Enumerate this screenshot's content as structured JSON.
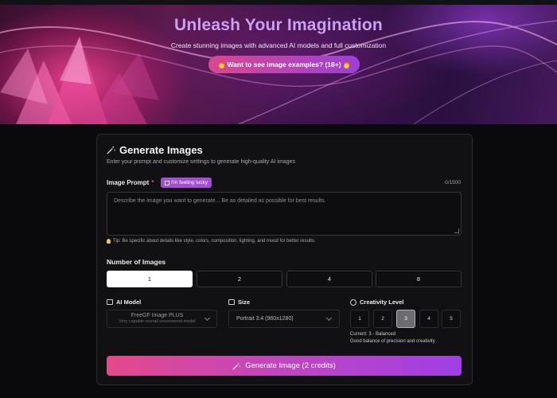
{
  "hero": {
    "title": "Unleash Your Imagination",
    "subtitle": "Create stunning images with advanced AI models and full customization",
    "examples_button": "Want to see image examples? (18+)"
  },
  "generate": {
    "title": "Generate Images",
    "subtitle": "Enter your prompt and customize settings to generate high-quality AI images",
    "prompt_label": "Image Prompt",
    "required_mark": "*",
    "lucky_button": "I'm feeling lucky",
    "char_count": "0/1500",
    "prompt_placeholder": "Describe the image you want to generate... Be as detailed as possible for best results.",
    "tip": "Tip: Be specific about details like style, colors, composition, lighting, and mood for better results.",
    "number_label": "Number of Images",
    "number_options": [
      "1",
      "2",
      "4",
      "8"
    ],
    "number_selected": "1",
    "model_label": "AI Model",
    "model_name": "FreeGF Image PLUS",
    "model_desc": "Very capable overall uncensored model",
    "size_label": "Size",
    "size_value": "Portrait 3:4 (960x1280)",
    "creativity_label": "Creativity Level",
    "creativity_options": [
      "1",
      "2",
      "3",
      "4",
      "5"
    ],
    "creativity_selected": "3",
    "creativity_current": "Current: 3 - Balanced",
    "creativity_desc": "Good balance of precision and creativity",
    "generate_button": "Generate Image (2 credits)"
  },
  "colors": {
    "accent_pink": "#e4498a",
    "accent_purple": "#9f3fe4",
    "panel_bg": "#111114",
    "page_bg": "#0a0a0d"
  }
}
